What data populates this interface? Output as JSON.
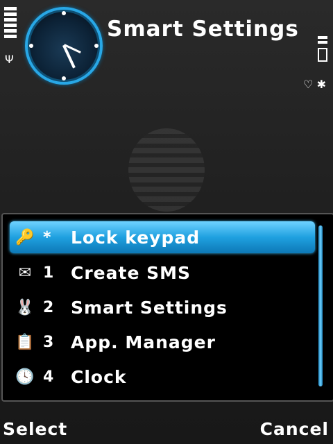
{
  "header": {
    "title": "Smart Settings",
    "signal_bars": 6
  },
  "menu": {
    "items": [
      {
        "key": "*",
        "label": "Lock keypad",
        "icon": "key-icon",
        "selected": true
      },
      {
        "key": "1",
        "label": "Create SMS",
        "icon": "envelope-icon",
        "selected": false
      },
      {
        "key": "2",
        "label": "Smart Settings",
        "icon": "rabbit-icon",
        "selected": false
      },
      {
        "key": "3",
        "label": "App. Manager",
        "icon": "clipboard-icon",
        "selected": false
      },
      {
        "key": "4",
        "label": "Clock",
        "icon": "clock-icon",
        "selected": false
      }
    ]
  },
  "softkeys": {
    "left": "Select",
    "right": "Cancel"
  },
  "colors": {
    "accent": "#1fa1e0",
    "background": "#1e1e1e",
    "menu_bg": "#000000"
  }
}
